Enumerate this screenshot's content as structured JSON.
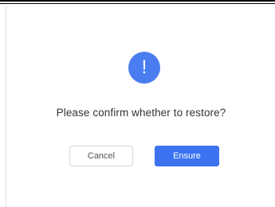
{
  "dialog": {
    "icon": "exclamation-circle-icon",
    "icon_glyph": "!",
    "message": "Please confirm whether to restore?",
    "cancel_label": "Cancel",
    "ensure_label": "Ensure"
  },
  "colors": {
    "accent": "#3b73f0",
    "icon_background": "#4a7df0",
    "text": "#333333",
    "cancel_border": "#d9d9d9"
  }
}
